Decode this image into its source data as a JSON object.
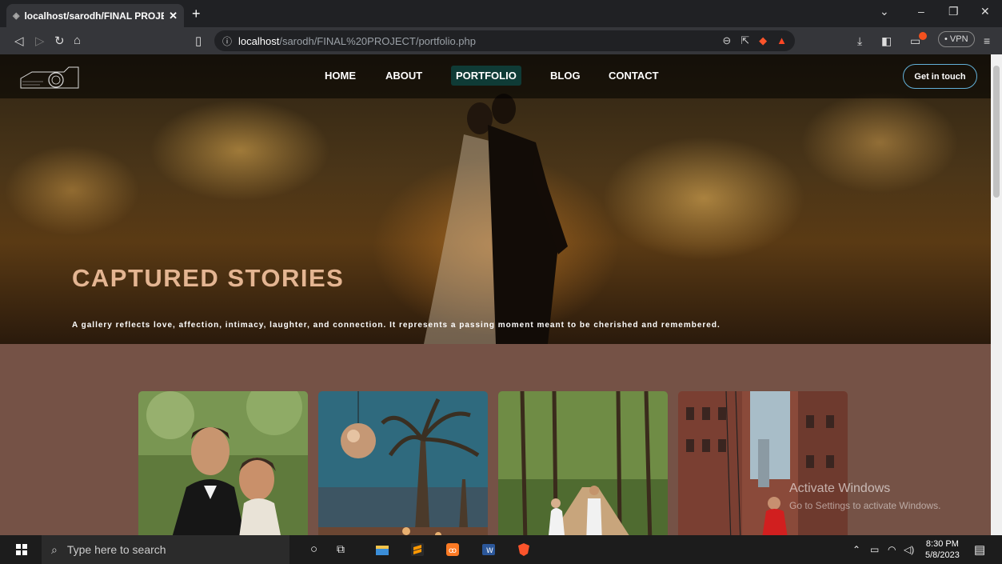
{
  "browser": {
    "tab_title": "localhost/sarodh/FINAL PROJECT",
    "tab_close": "✕",
    "new_tab": "+",
    "url_host": "localhost",
    "url_path": "/sarodh/FINAL%20PROJECT/portfolio.php",
    "vpn_label": "• VPN",
    "window_controls": [
      "⌄",
      "–",
      "❐",
      "✕"
    ]
  },
  "site": {
    "nav": [
      "HOME",
      "ABOUT",
      "PORTFOLIO",
      "BLOG",
      "CONTACT"
    ],
    "active_nav": "PORTFOLIO",
    "cta": "Get in touch",
    "hero_title": "CAPTURED STORIES",
    "hero_subtitle": "A gallery reflects love, affection, intimacy, laughter, and connection. It represents a passing moment meant to be cherished and remembered.",
    "accent_color": "#e4b592",
    "section_bg": "#755246"
  },
  "watermark": {
    "title": "Activate Windows",
    "subtitle": "Go to Settings to activate Windows."
  },
  "taskbar": {
    "search_placeholder": "Type here to search",
    "time": "8:30 PM",
    "date": "5/8/2023"
  }
}
